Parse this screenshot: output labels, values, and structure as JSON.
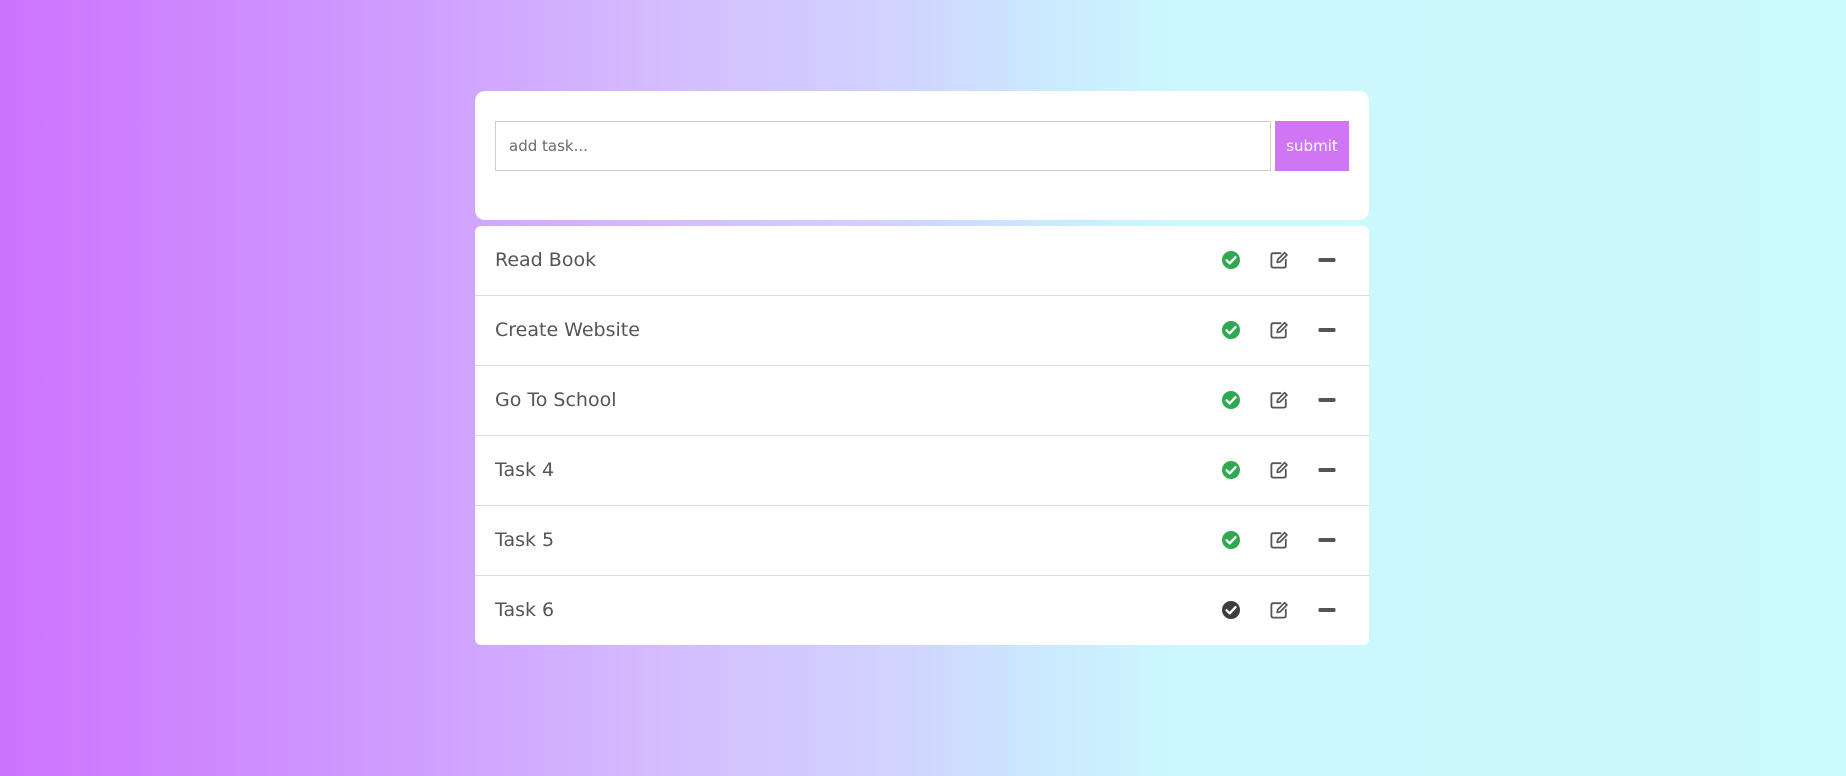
{
  "add_task": {
    "placeholder": "add task...",
    "value": "",
    "submit_label": "submit"
  },
  "tasks": [
    {
      "label": "Read Book",
      "done": true
    },
    {
      "label": "Create Website",
      "done": true
    },
    {
      "label": "Go To School",
      "done": true
    },
    {
      "label": "Task 4",
      "done": true
    },
    {
      "label": "Task 5",
      "done": true
    },
    {
      "label": "Task 6",
      "done": false
    }
  ],
  "icons": {
    "check": "check-circle-icon",
    "edit": "edit-icon",
    "remove": "minus-icon"
  },
  "colors": {
    "accent": "#d076f5",
    "done": "#2fa84f",
    "not_done": "#3d3d3d",
    "icon": "#555555",
    "text": "#555555"
  }
}
